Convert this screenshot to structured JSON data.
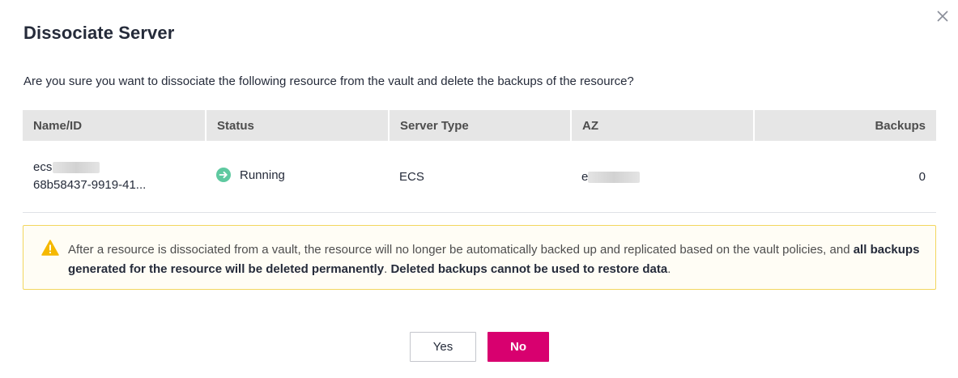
{
  "dialog": {
    "title": "Dissociate Server",
    "question": "Are you sure you want to dissociate the following resource from the vault and delete the backups of the resource?"
  },
  "table": {
    "headers": {
      "name_id": "Name/ID",
      "status": "Status",
      "server_type": "Server Type",
      "az": "AZ",
      "backups": "Backups"
    },
    "rows": [
      {
        "name": "ecs",
        "id": "68b58437-9919-41...",
        "status": "Running",
        "server_type": "ECS",
        "az": "e",
        "backups": "0"
      }
    ]
  },
  "warning": {
    "text_before": "After a resource is dissociated from a vault, the resource will no longer be automatically backed up and replicated based on the vault policies, and ",
    "bold_1": "all backups generated for the resource will be deleted permanently",
    "middle": ". ",
    "bold_2": "Deleted backups cannot be used to restore data",
    "end": "."
  },
  "buttons": {
    "yes_label": "Yes",
    "no_label": "No"
  },
  "icons": {
    "close": "close-icon",
    "status": "running-arrow-icon",
    "warning": "warning-triangle-icon"
  },
  "colors": {
    "primary": "#d8006f",
    "running": "#5ec9a0",
    "warning_border": "#f2d65e",
    "warning_icon": "#f5b800",
    "header_bg": "#e6e6e6"
  }
}
